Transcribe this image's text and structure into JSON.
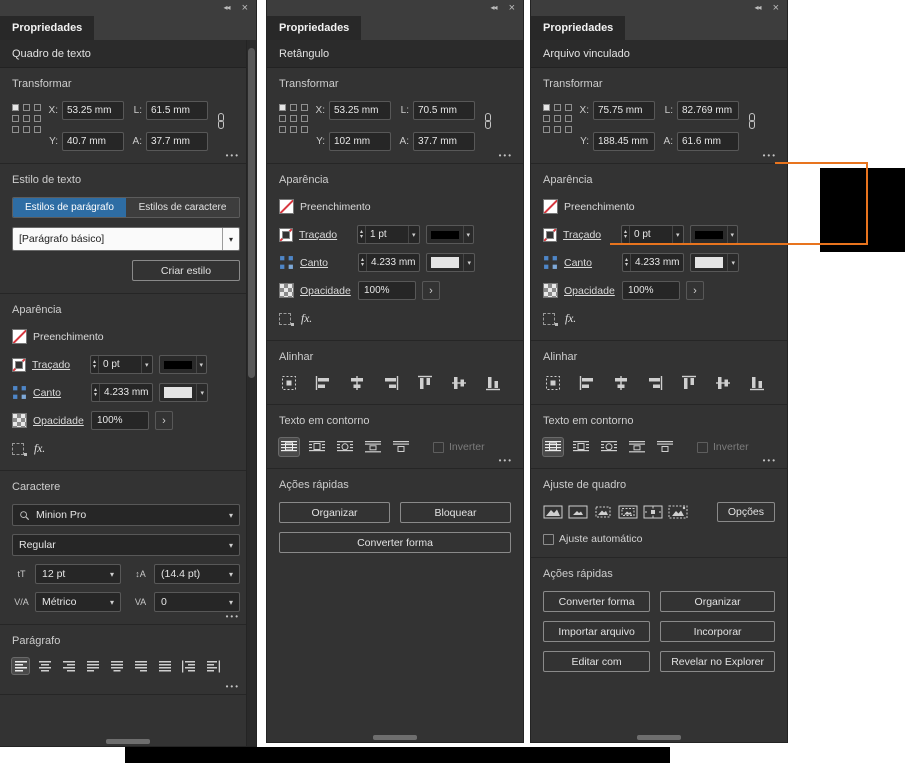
{
  "colors": {
    "accent_blue": "#2e6da4",
    "annotation": "#e8741e",
    "redaction": "#000000",
    "swatch_red": "#d7373f",
    "panel_bg": "#333333"
  },
  "icons": {
    "collapse": "◂◂",
    "close": "×",
    "more": "•••",
    "step_up": "▴",
    "step_down": "▾",
    "dropdown": "▾",
    "expander": "›"
  },
  "shared": {
    "tab": "Propriedades",
    "transform_title": "Transformar",
    "x_label": "X:",
    "y_label": "Y:",
    "w_label": "L:",
    "h_label": "A:",
    "appearance_title": "Aparência",
    "fill_label": "Preenchimento",
    "stroke_label": "Traçado",
    "corner_label": "Canto",
    "corner_value": "4.233 mm",
    "opacity_label": "Opacidade",
    "opacity_value": "100%",
    "fx_label": "fx.",
    "align_title": "Alinhar",
    "wrap_title": "Texto em contorno",
    "invert_label": "Inverter",
    "quick_title": "Ações rápidas"
  },
  "panel1": {
    "subtitle": "Quadro de texto",
    "transform": {
      "x": "53.25 mm",
      "y": "40.7 mm",
      "w": "61.5 mm",
      "h": "37.7 mm"
    },
    "stroke_value": "0 pt",
    "text_style": {
      "title": "Estilo de texto",
      "tab_paragraph": "Estilos de parágrafo",
      "tab_character": "Estilos de caractere",
      "style_value": "[Parágrafo básico]",
      "create_button": "Criar estilo"
    },
    "character": {
      "title": "Caractere",
      "font": "Minion Pro",
      "style": "Regular",
      "size": "12 pt",
      "leading": "(14.4 pt)",
      "kerning": "Métrico",
      "tracking": "0",
      "size_icon": "tT",
      "leading_icon": "↕A",
      "kerning_icon": "V/A",
      "tracking_icon": "VA"
    },
    "paragraph_title": "Parágrafo"
  },
  "panel2": {
    "subtitle": "Retângulo",
    "transform": {
      "x": "53.25 mm",
      "y": "102 mm",
      "w": "70.5 mm",
      "h": "37.7 mm"
    },
    "stroke_value": "1 pt",
    "quick_buttons": [
      "Organizar",
      "Bloquear",
      "Converter forma"
    ]
  },
  "panel3": {
    "subtitle": "Arquivo vinculado",
    "transform": {
      "x": "75.75 mm",
      "y": "188.45 mm",
      "w": "82.769 mm",
      "h": "61.6 mm"
    },
    "stroke_value": "0 pt",
    "fitting": {
      "title": "Ajuste de quadro",
      "options_button": "Opções",
      "auto_label": "Ajuste automático"
    },
    "quick_buttons": [
      "Converter forma",
      "Organizar",
      "Importar arquivo",
      "Incorporar",
      "Editar com",
      "Revelar no Explorer"
    ]
  }
}
